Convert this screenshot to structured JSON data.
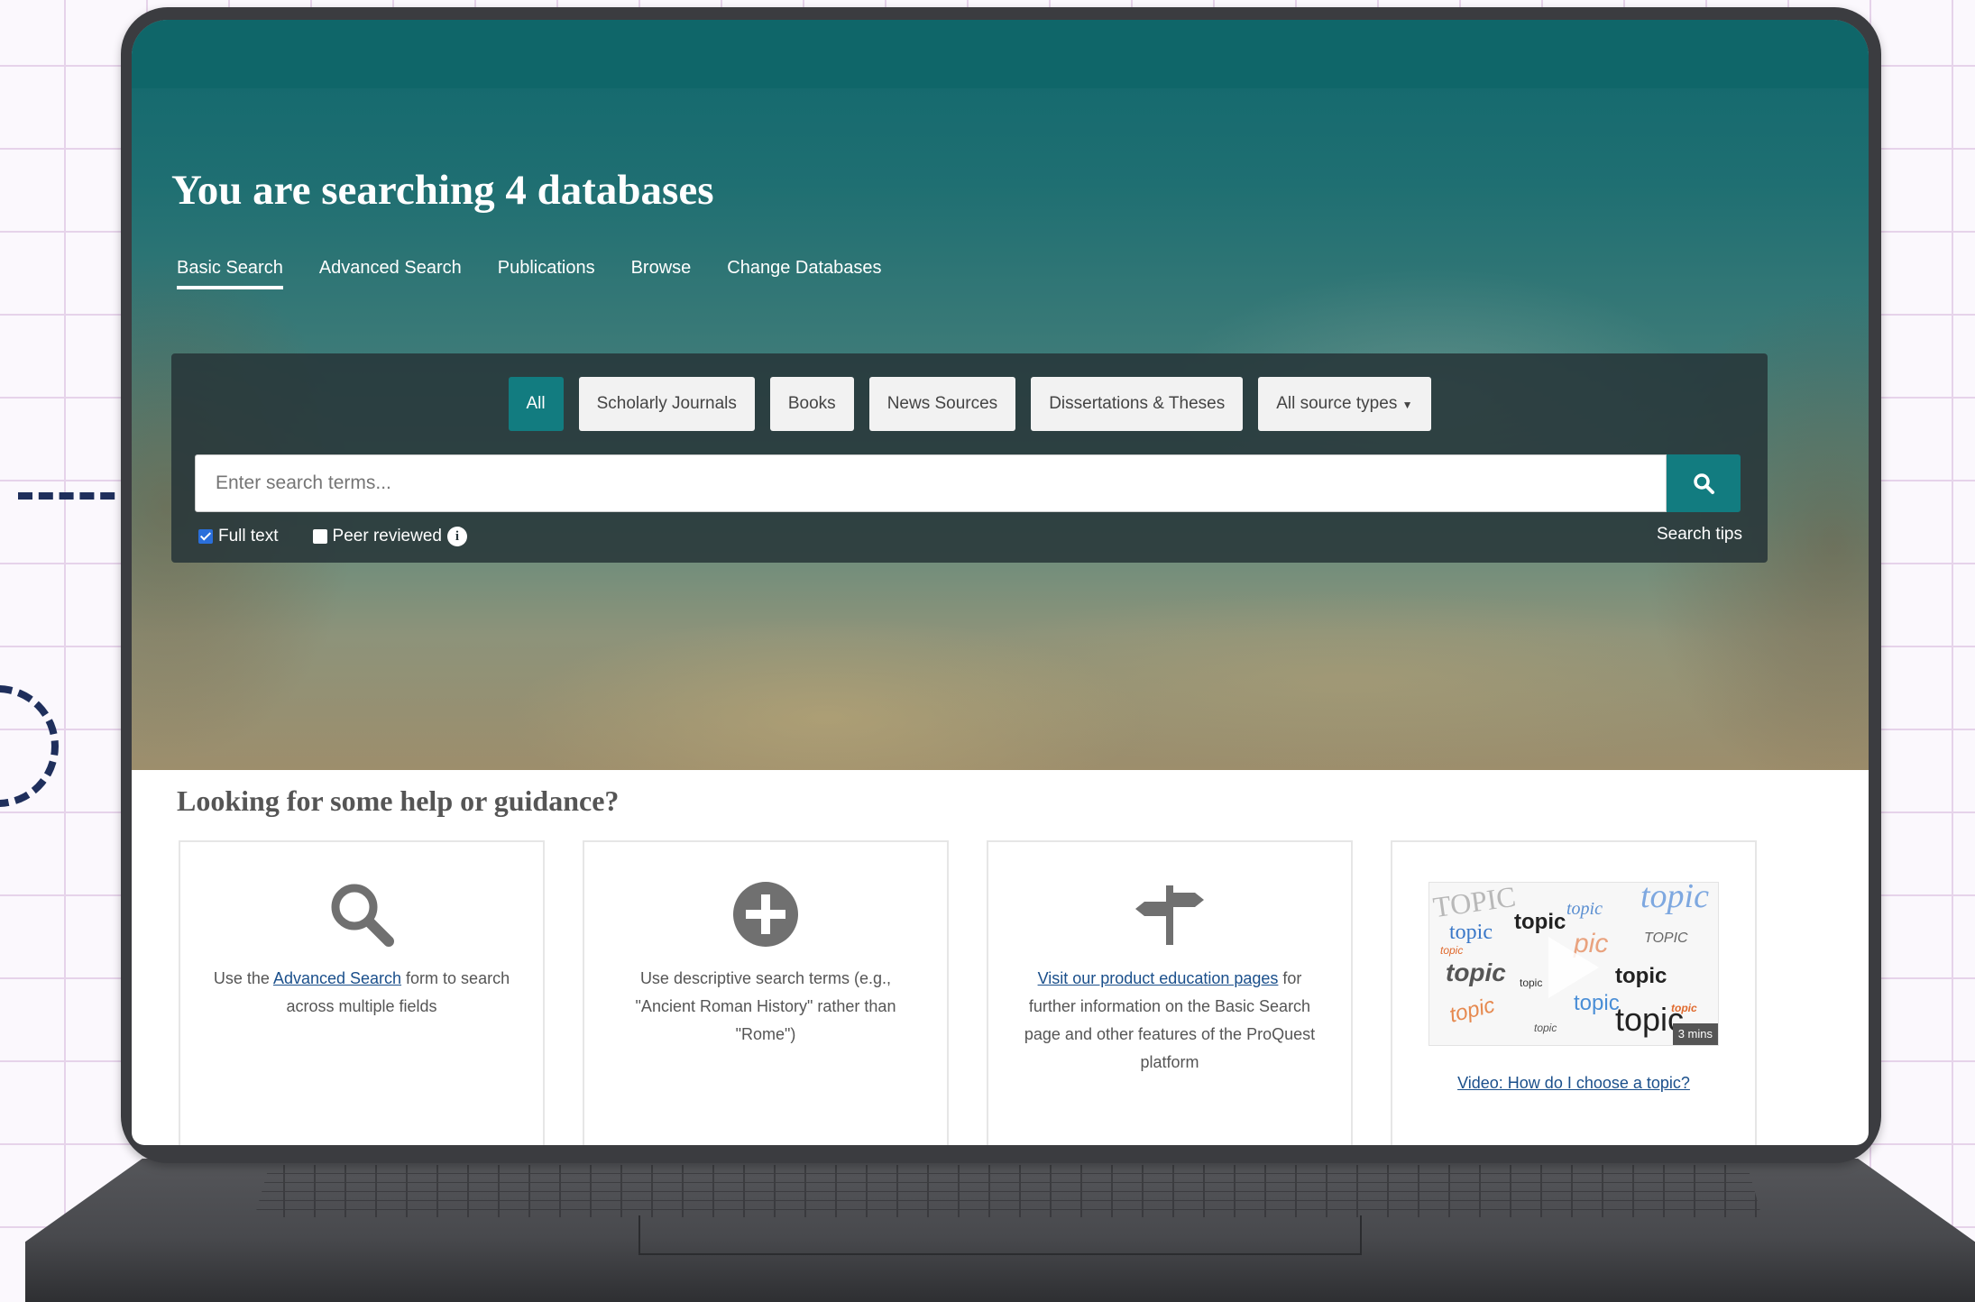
{
  "hero": {
    "title_prefix": "You are searching",
    "title_bold": "4 databases"
  },
  "tabs": [
    {
      "label": "Basic Search",
      "active": true
    },
    {
      "label": "Advanced Search",
      "active": false
    },
    {
      "label": "Publications",
      "active": false
    },
    {
      "label": "Browse",
      "active": false
    },
    {
      "label": "Change Databases",
      "active": false
    }
  ],
  "filters": {
    "all": "All",
    "scholarly": "Scholarly Journals",
    "books": "Books",
    "news": "News Sources",
    "dissertations": "Dissertations & Theses",
    "all_types": "All source types"
  },
  "search": {
    "placeholder": "Enter search terms...",
    "full_text": "Full text",
    "full_text_checked": true,
    "peer_reviewed": "Peer reviewed",
    "peer_reviewed_checked": false,
    "tips": "Search tips",
    "button_icon": "search-icon"
  },
  "help": {
    "title": "Looking for some help or guidance?",
    "card1": {
      "icon": "magnifier-icon",
      "pre": "Use the ",
      "link": "Advanced Search",
      "post": " form to search across multiple fields"
    },
    "card2": {
      "icon": "plus-circle-icon",
      "text": "Use descriptive search terms (e.g., \"Ancient Roman History\" rather than \"Rome\")"
    },
    "card3": {
      "icon": "signpost-icon",
      "link": "Visit our product education pages",
      "post": " for further information on the Basic Search page and other features of the ProQuest platform"
    },
    "card4": {
      "icon": "play-icon",
      "link": "Video: How do I choose a topic?",
      "duration": "3 mins"
    }
  },
  "colors": {
    "accent": "#127c80",
    "topbar": "#0f6669",
    "link": "#1a4f8b"
  }
}
